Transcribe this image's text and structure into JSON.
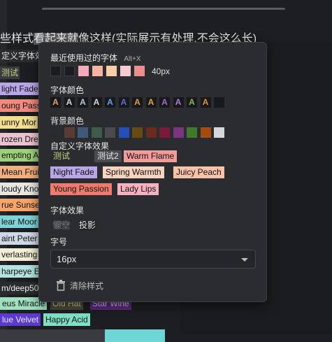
{
  "heading": {
    "prefix": "些样式",
    "highlight": "看起来就",
    "suffix": "像这样(实际展示有处理,不会这么长)"
  },
  "background_items": [
    {
      "label": "定义字体效",
      "bg": "#2b2c30",
      "color": "#e0e0e0"
    },
    {
      "label": "测试",
      "bg": "#3a3b40",
      "color": "#c8d27a"
    },
    {
      "label": "light Fade",
      "bg": "#b9a6e6",
      "color": "#111111"
    },
    {
      "label": "oung Pass",
      "bg": "#f08a7c",
      "color": "#111111"
    },
    {
      "label": "unny Mor",
      "bg": "#f2e08f",
      "color": "#111111"
    },
    {
      "label": "rozen Dre",
      "bg": "#e9c3cf",
      "color": "#111111"
    },
    {
      "label": "empting A",
      "bg": "#9fd07a",
      "color": "#111111"
    },
    {
      "label": "Mean Fruit",
      "bg": "#f4b07c",
      "color": "#111111"
    },
    {
      "label": "loudy Kno",
      "bg": "#e9e6e2",
      "color": "#111111"
    },
    {
      "label": "rue Sunse",
      "bg": "#f7a66a",
      "color": "#111111"
    },
    {
      "label": "lear Moor",
      "bg": "#7fd3d8",
      "color": "#111111"
    },
    {
      "label": "aint Peter",
      "bg": "#cfd8e6",
      "color": "#111111"
    },
    {
      "label": "verlasting",
      "bg": "#f3eed6",
      "color": "#111111"
    },
    {
      "label": "harpeye E",
      "bg": "#b4e3df",
      "color": "#111111"
    },
    {
      "label": "m/deep50",
      "bg": "#2a2b2f",
      "color": "#f0f0f0"
    }
  ],
  "bottom_row1": [
    "eus Miracle",
    "Old Hat",
    "Star Wine"
  ],
  "bottom_row2": [
    "lue Velvet",
    "Happy Acid"
  ],
  "popup": {
    "recent_title": "最近使用过的字体",
    "recent_shortcut": "Alt+X",
    "recent_swatches": [
      "#1b1c1f",
      "#1b1c1f",
      "#f6a9b8",
      "#f7b4a3",
      "#f7cfa7",
      "#f8c9d3",
      "#ef8e8e"
    ],
    "recent_size": "40px",
    "font_color_title": "字体颜色",
    "font_colors": [
      {
        "glyph": "A",
        "color": "#e3a26e"
      },
      {
        "glyph": "A",
        "color": "#d7d7d7"
      },
      {
        "glyph": "A",
        "color": "#b5c9d9"
      },
      {
        "glyph": "A",
        "color": "#d7d7d7"
      },
      {
        "glyph": "A",
        "color": "#6f9fe0"
      },
      {
        "glyph": "A",
        "color": "#5673d6"
      },
      {
        "glyph": "A",
        "color": "#d9a441"
      },
      {
        "glyph": "A",
        "color": "#e0a24a"
      },
      {
        "glyph": "A",
        "color": "#a46ad1"
      },
      {
        "glyph": "A",
        "color": "#b77cd8"
      },
      {
        "glyph": "A",
        "color": "#8fb84a"
      },
      {
        "glyph": "A",
        "color": "#e0923a"
      },
      {
        "glyph": "",
        "color": "#2b2c30"
      }
    ],
    "bg_color_title": "背景颜色",
    "bg_colors": [
      "#2a2b2f",
      "#5a3a34",
      "#3e5a78",
      "#3d5d4a",
      "#4a4b50",
      "#2250b8",
      "#6a4a14",
      "#6a2a1e",
      "#7a1a3a",
      "#7a3480",
      "#3f7a2c",
      "#a24c10",
      "#d5d7db"
    ],
    "custom_title": "自定义字体效果",
    "custom_tags": [
      {
        "label": "测试",
        "bg": "#2b2c30",
        "color": "#c8d27a"
      },
      {
        "label": "测试2",
        "bg": "#4a4b50",
        "color": "#e6e6e6"
      },
      {
        "label": "Warm Flame",
        "bg": "#f39a9a",
        "color": "#111111"
      },
      {
        "label": "Night Fade",
        "bg": "#b9a6e6",
        "color": "#111111"
      },
      {
        "label": "Spring Warmth",
        "bg": "#f8d3bf",
        "color": "#111111"
      },
      {
        "label": "Juicy Peach",
        "bg": "#fbc2a8",
        "color": "#111111"
      },
      {
        "label": "Young Passion",
        "bg": "#f07a6e",
        "color": "#111111"
      },
      {
        "label": "Lady Lips",
        "bg": "#f7b1c0",
        "color": "#111111"
      }
    ],
    "effect_title": "字体效果",
    "effect_hollow": "镂空",
    "effect_shadow": "投影",
    "size_title": "字号",
    "size_value": "16px",
    "clear_label": "清除样式"
  }
}
